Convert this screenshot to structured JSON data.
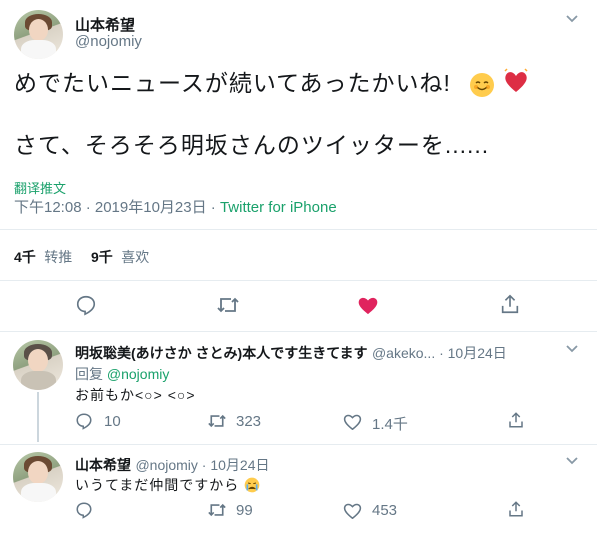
{
  "main_tweet": {
    "display_name": "山本希望",
    "handle": "@nojomiy",
    "line1": "めでたいニュースが続いてあったかいね!",
    "line2": "さて、そろそろ明坂さんのツイッターを......",
    "translate_label": "翻译推文",
    "timestamp": "下午12:08 · 2019年10月23日 · ",
    "source": "Twitter for iPhone",
    "retweets_count": "4千",
    "retweets_label": "转推",
    "likes_count": "9千",
    "likes_label": "喜欢"
  },
  "reply1": {
    "display_name": "明坂聡美(あけさか さとみ)本人です生きてます",
    "handle_date": "@akeko... · 10月24日",
    "reply_to_prefix": "回复 ",
    "reply_to_handle": "@nojomiy",
    "text": "お前もか<○> <○>",
    "reply_count": "10",
    "retweet_count": "323",
    "like_count": "1.4千"
  },
  "reply2": {
    "display_name": "山本希望",
    "handle_date": "@nojomiy · 10月24日",
    "text": "いうてまだ仲間ですから",
    "retweet_count": "99",
    "like_count": "453"
  },
  "colors": {
    "like_active": "#e0245e",
    "link": "#1aa16b",
    "accent": "#1da1f2",
    "secondary_text": "#657786"
  }
}
